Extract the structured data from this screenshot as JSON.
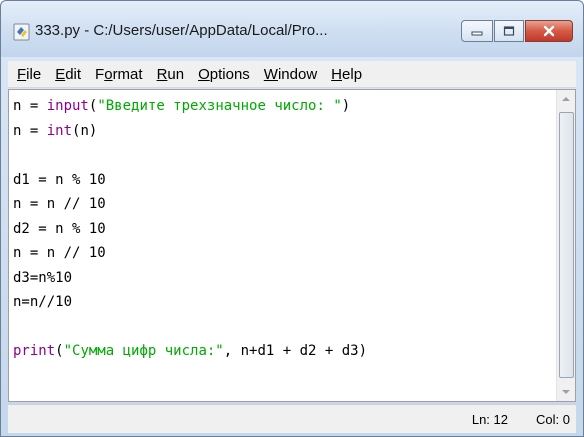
{
  "window": {
    "title": "333.py - C:/Users/user/AppData/Local/Pro..."
  },
  "menu": {
    "items": [
      {
        "label": "File",
        "underline": "F",
        "rest": "ile"
      },
      {
        "label": "Edit",
        "underline": "E",
        "rest": "dit"
      },
      {
        "label": "Format",
        "underline": "o",
        "pre": "F",
        "rest": "rmat"
      },
      {
        "label": "Run",
        "underline": "R",
        "rest": "un"
      },
      {
        "label": "Options",
        "underline": "O",
        "rest": "ptions"
      },
      {
        "label": "Window",
        "underline": "W",
        "rest": "indow"
      },
      {
        "label": "Help",
        "underline": "H",
        "rest": "elp"
      }
    ]
  },
  "code": {
    "lines": [
      {
        "tokens": [
          {
            "t": "n = ",
            "c": ""
          },
          {
            "t": "input",
            "c": "kw"
          },
          {
            "t": "(",
            "c": ""
          },
          {
            "t": "\"Введите трехзначное число: \"",
            "c": "str"
          },
          {
            "t": ")",
            "c": ""
          }
        ]
      },
      {
        "tokens": [
          {
            "t": "n = ",
            "c": ""
          },
          {
            "t": "int",
            "c": "kw"
          },
          {
            "t": "(n)",
            "c": ""
          }
        ]
      },
      {
        "tokens": []
      },
      {
        "tokens": [
          {
            "t": "d1 = n % 10",
            "c": ""
          }
        ]
      },
      {
        "tokens": [
          {
            "t": "n = n // 10",
            "c": ""
          }
        ]
      },
      {
        "tokens": [
          {
            "t": "d2 = n % 10",
            "c": ""
          }
        ]
      },
      {
        "tokens": [
          {
            "t": "n = n // 10",
            "c": ""
          }
        ]
      },
      {
        "tokens": [
          {
            "t": "d3=n%10",
            "c": ""
          }
        ]
      },
      {
        "tokens": [
          {
            "t": "n=n//10",
            "c": ""
          }
        ]
      },
      {
        "tokens": []
      },
      {
        "tokens": [
          {
            "t": "print",
            "c": "kw"
          },
          {
            "t": "(",
            "c": ""
          },
          {
            "t": "\"Сумма цифр числа:\"",
            "c": "str"
          },
          {
            "t": ", n+d1 + d2 + d3)",
            "c": ""
          }
        ]
      }
    ]
  },
  "status": {
    "ln": "Ln: 12",
    "col": "Col: 0"
  },
  "colors": {
    "keyword": "#900090",
    "string": "#00aa00",
    "close_button": "#c0392b"
  }
}
